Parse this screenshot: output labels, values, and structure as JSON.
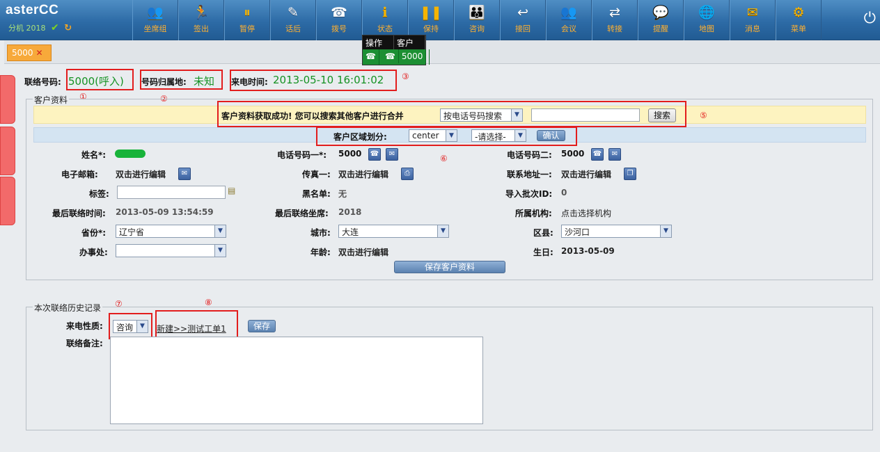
{
  "app": {
    "brand": "asterCC",
    "extension_label": "分机",
    "extension": "2018"
  },
  "toolbar": [
    {
      "label": "坐席组",
      "icon": "agent-group-icon",
      "glyph": "👥",
      "gold": true
    },
    {
      "label": "签出",
      "icon": "sign-out-icon",
      "glyph": "🏃",
      "gold": false
    },
    {
      "label": "暂停",
      "icon": "pause-icon",
      "glyph": "⏸",
      "gold": true
    },
    {
      "label": "话后",
      "icon": "after-call-icon",
      "glyph": "✎",
      "gold": false
    },
    {
      "label": "拨号",
      "icon": "dial-icon",
      "glyph": "☎",
      "gold": false
    },
    {
      "label": "状态",
      "icon": "status-icon",
      "glyph": "ℹ",
      "gold": true
    },
    {
      "label": "保持",
      "icon": "hold-icon",
      "glyph": "❚❚",
      "gold": true
    },
    {
      "label": "咨询",
      "icon": "consult-icon",
      "glyph": "👪",
      "gold": true
    },
    {
      "label": "接回",
      "icon": "retrieve-icon",
      "glyph": "↩",
      "gold": false
    },
    {
      "label": "会议",
      "icon": "conference-icon",
      "glyph": "👥",
      "gold": false
    },
    {
      "label": "转接",
      "icon": "transfer-icon",
      "glyph": "⇄",
      "gold": false
    },
    {
      "label": "提醒",
      "icon": "reminder-icon",
      "glyph": "💬",
      "gold": true
    },
    {
      "label": "地图",
      "icon": "map-icon",
      "glyph": "🌐",
      "gold": false
    },
    {
      "label": "消息",
      "icon": "message-icon",
      "glyph": "✉",
      "gold": true
    },
    {
      "label": "菜单",
      "icon": "menu-icon",
      "glyph": "⚙",
      "gold": true
    }
  ],
  "tab": {
    "label": "5000"
  },
  "popup": {
    "col1": "操作",
    "col2": "客户",
    "value": "5000"
  },
  "header": {
    "contact_no_label": "联络号码:",
    "contact_no_value": "5000(呼入)",
    "location_label": "号码归属地:",
    "location_value": "未知",
    "time_label": "来电时间:",
    "time_value": "2013-05-10 16:01:02"
  },
  "markers": [
    "①",
    "②",
    "③",
    "⑤",
    "⑥",
    "⑦",
    "⑧"
  ],
  "customer": {
    "legend": "客户资料",
    "notice": "客户资料获取成功! 您可以搜索其他客户进行合并",
    "search_select": "按电话号码搜索",
    "search_button": "搜索",
    "region_label": "客户区域划分:",
    "region_select1": "center",
    "region_select2": "-请选择-",
    "confirm_button": "确认",
    "fields": {
      "name_label": "姓名*:",
      "phone1_label": "电话号码一*:",
      "phone1_value": "5000",
      "phone2_label": "电话号码二:",
      "phone2_value": "5000",
      "email_label": "电子邮箱:",
      "email_value": "双击进行编辑",
      "fax_label": "传真一:",
      "fax_value": "双击进行编辑",
      "address_label": "联系地址一:",
      "address_value": "双击进行编辑",
      "tags_label": "标签:",
      "blacklist_label": "黑名单:",
      "blacklist_value": "无",
      "batch_label": "导入批次ID:",
      "batch_value": "0",
      "last_time_label": "最后联络时间:",
      "last_time_value": "2013-05-09 13:54:59",
      "last_agent_label": "最后联络坐席:",
      "last_agent_value": "2018",
      "org_label": "所属机构:",
      "org_value": "点击选择机构",
      "province_label": "省份*:",
      "province_value": "辽宁省",
      "city_label": "城市:",
      "city_value": "大连",
      "district_label": "区县:",
      "district_value": "沙河口",
      "office_label": "办事处:",
      "office_value": "",
      "age_label": "年龄:",
      "age_value": "双击进行编辑",
      "birthday_label": "生日:",
      "birthday_value": "2013-05-09"
    },
    "save_button": "保存客户资料"
  },
  "history": {
    "legend": "本次联络历史记录",
    "nature_label": "来电性质:",
    "nature_value": "咨询",
    "new_ticket_link": "新建>>测试工单1",
    "save_button": "保存",
    "remark_label": "联络备注:"
  }
}
